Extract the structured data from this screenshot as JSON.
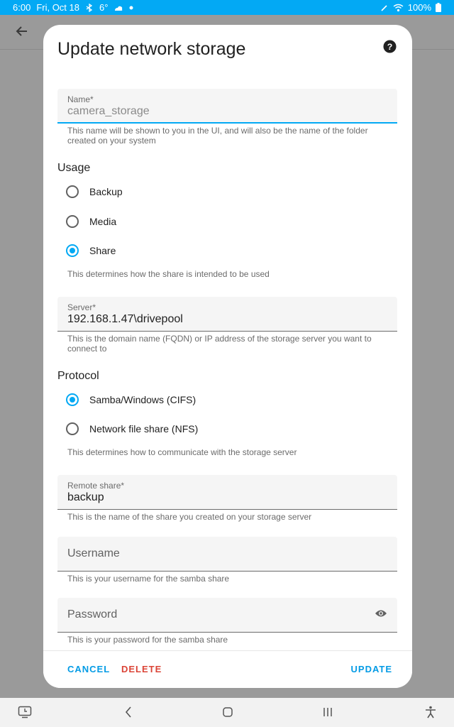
{
  "status_bar": {
    "time": "6:00",
    "date": "Fri, Oct 18",
    "temperature": "6°",
    "battery": "100%"
  },
  "dialog": {
    "title": "Update network storage",
    "name_field": {
      "label": "Name*",
      "value": "camera_storage",
      "helper": "This name will be shown to you in the UI, and will also be the name of the folder created on your system"
    },
    "usage": {
      "title": "Usage",
      "options": [
        {
          "label": "Backup",
          "checked": false
        },
        {
          "label": "Media",
          "checked": false
        },
        {
          "label": "Share",
          "checked": true
        }
      ],
      "helper": "This determines how the share is intended to be used"
    },
    "server_field": {
      "label": "Server*",
      "value": "192.168.1.47\\drivepool",
      "helper": "This is the domain name (FQDN) or IP address of the storage server you want to connect to"
    },
    "protocol": {
      "title": "Protocol",
      "options": [
        {
          "label": "Samba/Windows (CIFS)",
          "checked": true
        },
        {
          "label": "Network file share (NFS)",
          "checked": false
        }
      ],
      "helper": "This determines how to communicate with the storage server"
    },
    "remote_share_field": {
      "label": "Remote share*",
      "value": "backup",
      "helper": "This is the name of the share you created on your storage server"
    },
    "username_field": {
      "placeholder": "Username",
      "helper": "This is your username for the samba share"
    },
    "password_field": {
      "placeholder": "Password",
      "helper": "This is your password for the samba share"
    },
    "actions": {
      "cancel": "CANCEL",
      "delete": "DELETE",
      "update": "UPDATE"
    }
  },
  "colors": {
    "accent": "#03a9f4",
    "danger": "#db4437"
  }
}
